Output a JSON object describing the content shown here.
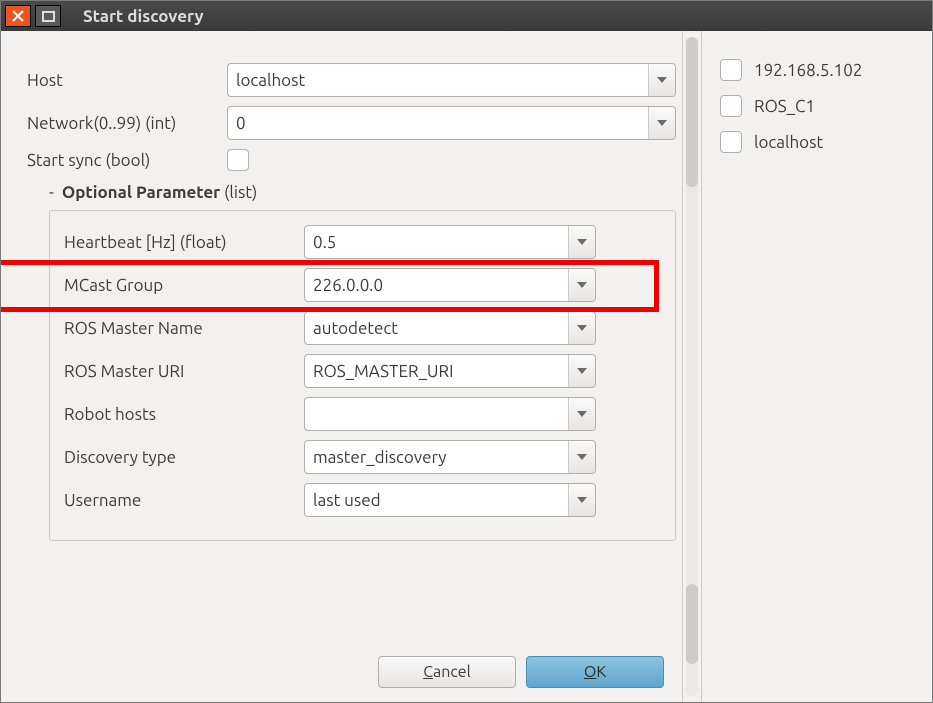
{
  "window": {
    "title": "Start discovery"
  },
  "form": {
    "host": {
      "label": "Host",
      "value": "localhost"
    },
    "network": {
      "label": "Network(0..99) (int)",
      "value": "0"
    },
    "start_sync": {
      "label": "Start sync (bool)"
    }
  },
  "optional": {
    "header": {
      "prefix": "-",
      "title": "Optional Parameter",
      "suffix": "(list)"
    },
    "rows": [
      {
        "label": "Heartbeat [Hz] (float)",
        "value": "0.5"
      },
      {
        "label": "MCast Group",
        "value": "226.0.0.0",
        "highlight": true
      },
      {
        "label": "ROS Master Name",
        "value": "autodetect"
      },
      {
        "label": "ROS Master URI",
        "value": "ROS_MASTER_URI"
      },
      {
        "label": "Robot hosts",
        "value": ""
      },
      {
        "label": "Discovery type",
        "value": "master_discovery"
      },
      {
        "label": "Username",
        "value": "last used"
      }
    ]
  },
  "hosts": [
    {
      "label": "192.168.5.102",
      "checked": false
    },
    {
      "label": "ROS_C1",
      "checked": false
    },
    {
      "label": "localhost",
      "checked": false
    }
  ],
  "footer": {
    "cancel": {
      "mnemonic": "C",
      "rest": "ancel"
    },
    "ok": {
      "mnemonic": "O",
      "rest": "K"
    }
  },
  "colors": {
    "highlight": "#f00000",
    "accent_ok": "#5fa6ce",
    "close": "#e95420"
  }
}
